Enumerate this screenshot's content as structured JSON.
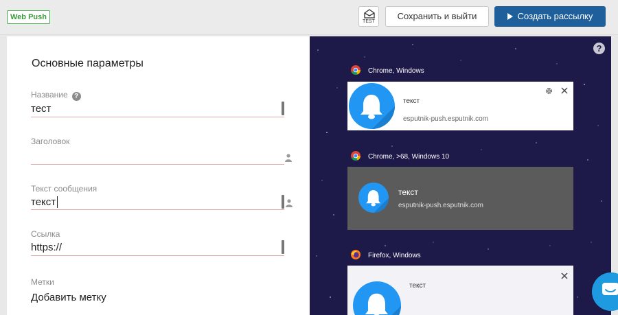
{
  "topbar": {
    "badge": "Web Push",
    "test_label": "TEST",
    "save_label": "Сохранить и выйти",
    "create_label": "Создать рассылку"
  },
  "form": {
    "section_title": "Основные параметры",
    "fields": [
      {
        "label": "Название",
        "value": "тест",
        "has_help": true
      },
      {
        "label": "Заголовок",
        "value": "",
        "has_personalize": true
      },
      {
        "label": "Текст сообщения",
        "value": "текст",
        "has_personalize": true
      },
      {
        "label": "Ссылка",
        "value": "https://"
      },
      {
        "label": "Метки",
        "value": "Добавить метку"
      }
    ]
  },
  "preview": {
    "help": "?",
    "items": [
      {
        "browser": "Chrome, Windows",
        "text": "текст",
        "url": "esputnik-push.esputnik.com"
      },
      {
        "browser": "Chrome, >68, Windows 10",
        "text": "текст",
        "url": "esputnik-push.esputnik.com"
      },
      {
        "browser": "Firefox, Windows",
        "text": "текст"
      }
    ]
  },
  "colors": {
    "accent": "#1f5f9c",
    "badge_green": "#4caf50",
    "bell_blue": "#2196f3",
    "preview_bg": "#1d1a4a",
    "field_underline": "#e0a9a3"
  }
}
